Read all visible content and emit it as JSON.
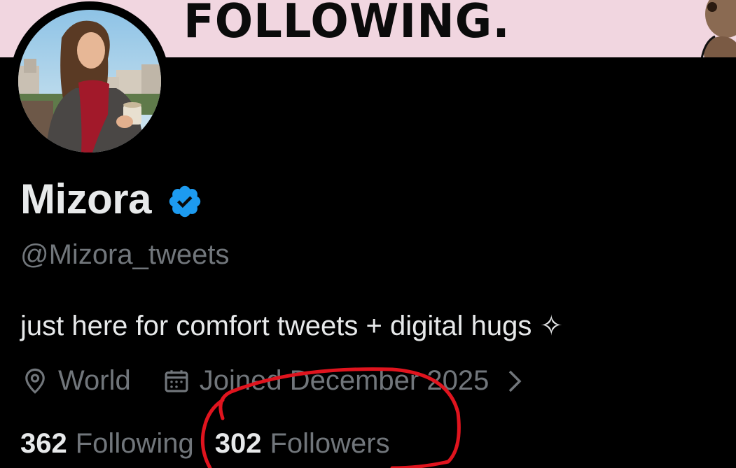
{
  "banner": {
    "text": "FOLLOWING."
  },
  "profile": {
    "display_name": "Mizora",
    "handle": "@Mizora_tweets",
    "bio": "just here for comfort tweets + digital hugs ✧",
    "location": "World",
    "joined": "Joined December 2025",
    "verified": true,
    "icons": {
      "verified": "verified-badge-icon",
      "location": "location-pin-icon",
      "joined": "calendar-icon",
      "more": "chevron-right-icon"
    }
  },
  "stats": {
    "following_count": "362",
    "following_label": "Following",
    "followers_count": "302",
    "followers_label": "Followers"
  },
  "colors": {
    "background": "#000000",
    "banner": "#f1d6e0",
    "primary_text": "#e7e9ea",
    "secondary_text": "#71767b",
    "verified_blue": "#1d9bf0",
    "annotation_red": "#e0141e"
  }
}
